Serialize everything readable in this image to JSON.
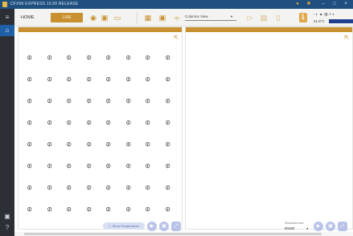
{
  "titlebar": {
    "title": "CFX96 EXPRESS 10.00 RELEASE"
  },
  "toolbar": {
    "home_label": "HOME",
    "live_label": "LIVE",
    "view_select": "Columns View",
    "temperature": "21.8°C"
  },
  "footer": {
    "show_temperature_label": "✓ Show Temperature",
    "resolution_label": "Resolution size",
    "resolution_value": "80x80"
  },
  "grid": {
    "rows": 8,
    "cols": 8,
    "cell_icon": "tube-icon"
  },
  "colors": {
    "accent": "#c8902e",
    "titlebar": "#1e4f7f",
    "sidebar": "#2c3036",
    "active_nav": "#1e5fa8",
    "control_blue": "#b9c3e8"
  }
}
